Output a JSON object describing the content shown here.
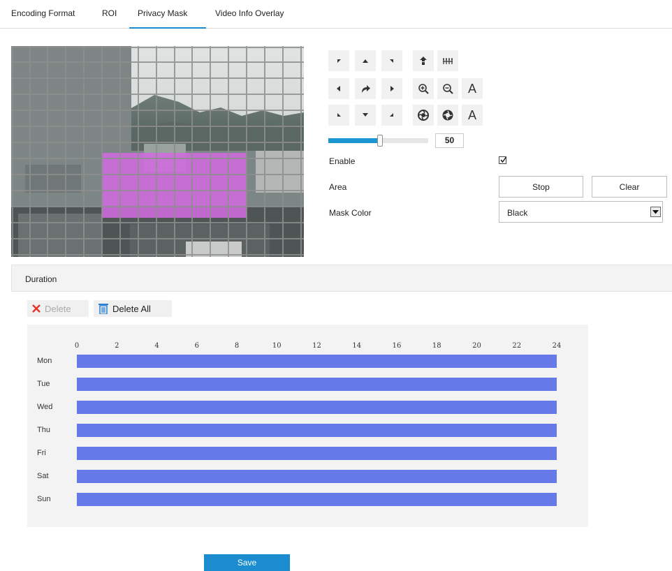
{
  "tabs": [
    {
      "label": "Encoding Format",
      "active": false
    },
    {
      "label": "ROI",
      "active": false
    },
    {
      "label": "Privacy Mask",
      "active": true
    },
    {
      "label": "Video Info Overlay",
      "active": false
    }
  ],
  "accent_color": "#1a8ccf",
  "mask_fill_color": "#d16be0",
  "ptz": {
    "buttons": [
      "up-left-arrow-icon",
      "up-arrow-icon",
      "up-right-arrow-icon",
      "focus-near-icon",
      "focus-far-icon",
      "left-arrow-icon",
      "auto-rotate-icon",
      "right-arrow-icon",
      "zoom-in-icon",
      "zoom-out-icon",
      "auto-zoom-icon",
      "down-left-arrow-icon",
      "down-arrow-icon",
      "down-right-arrow-icon",
      "iris-open-icon",
      "iris-close-icon",
      "auto-iris-icon"
    ],
    "speed_value": "50",
    "speed_level": 0.52
  },
  "form": {
    "enable_label": "Enable",
    "enable_checked": true,
    "area_label": "Area",
    "stop_label": "Stop",
    "clear_label": "Clear",
    "mask_color_label": "Mask Color",
    "mask_color_value": "Black"
  },
  "duration": {
    "title": "Duration",
    "delete_label": "Delete",
    "delete_all_label": "Delete All"
  },
  "schedule": {
    "hours": [
      "0",
      "2",
      "4",
      "6",
      "8",
      "10",
      "12",
      "14",
      "16",
      "18",
      "20",
      "22",
      "24"
    ],
    "days": [
      "Mon",
      "Tue",
      "Wed",
      "Thu",
      "Fri",
      "Sat",
      "Sun"
    ],
    "bar_color": "#6679e8",
    "ranges": [
      {
        "start": 0,
        "end": 24
      },
      {
        "start": 0,
        "end": 24
      },
      {
        "start": 0,
        "end": 24
      },
      {
        "start": 0,
        "end": 24
      },
      {
        "start": 0,
        "end": 24
      },
      {
        "start": 0,
        "end": 24
      },
      {
        "start": 0,
        "end": 24
      }
    ]
  },
  "save_label": "Save"
}
